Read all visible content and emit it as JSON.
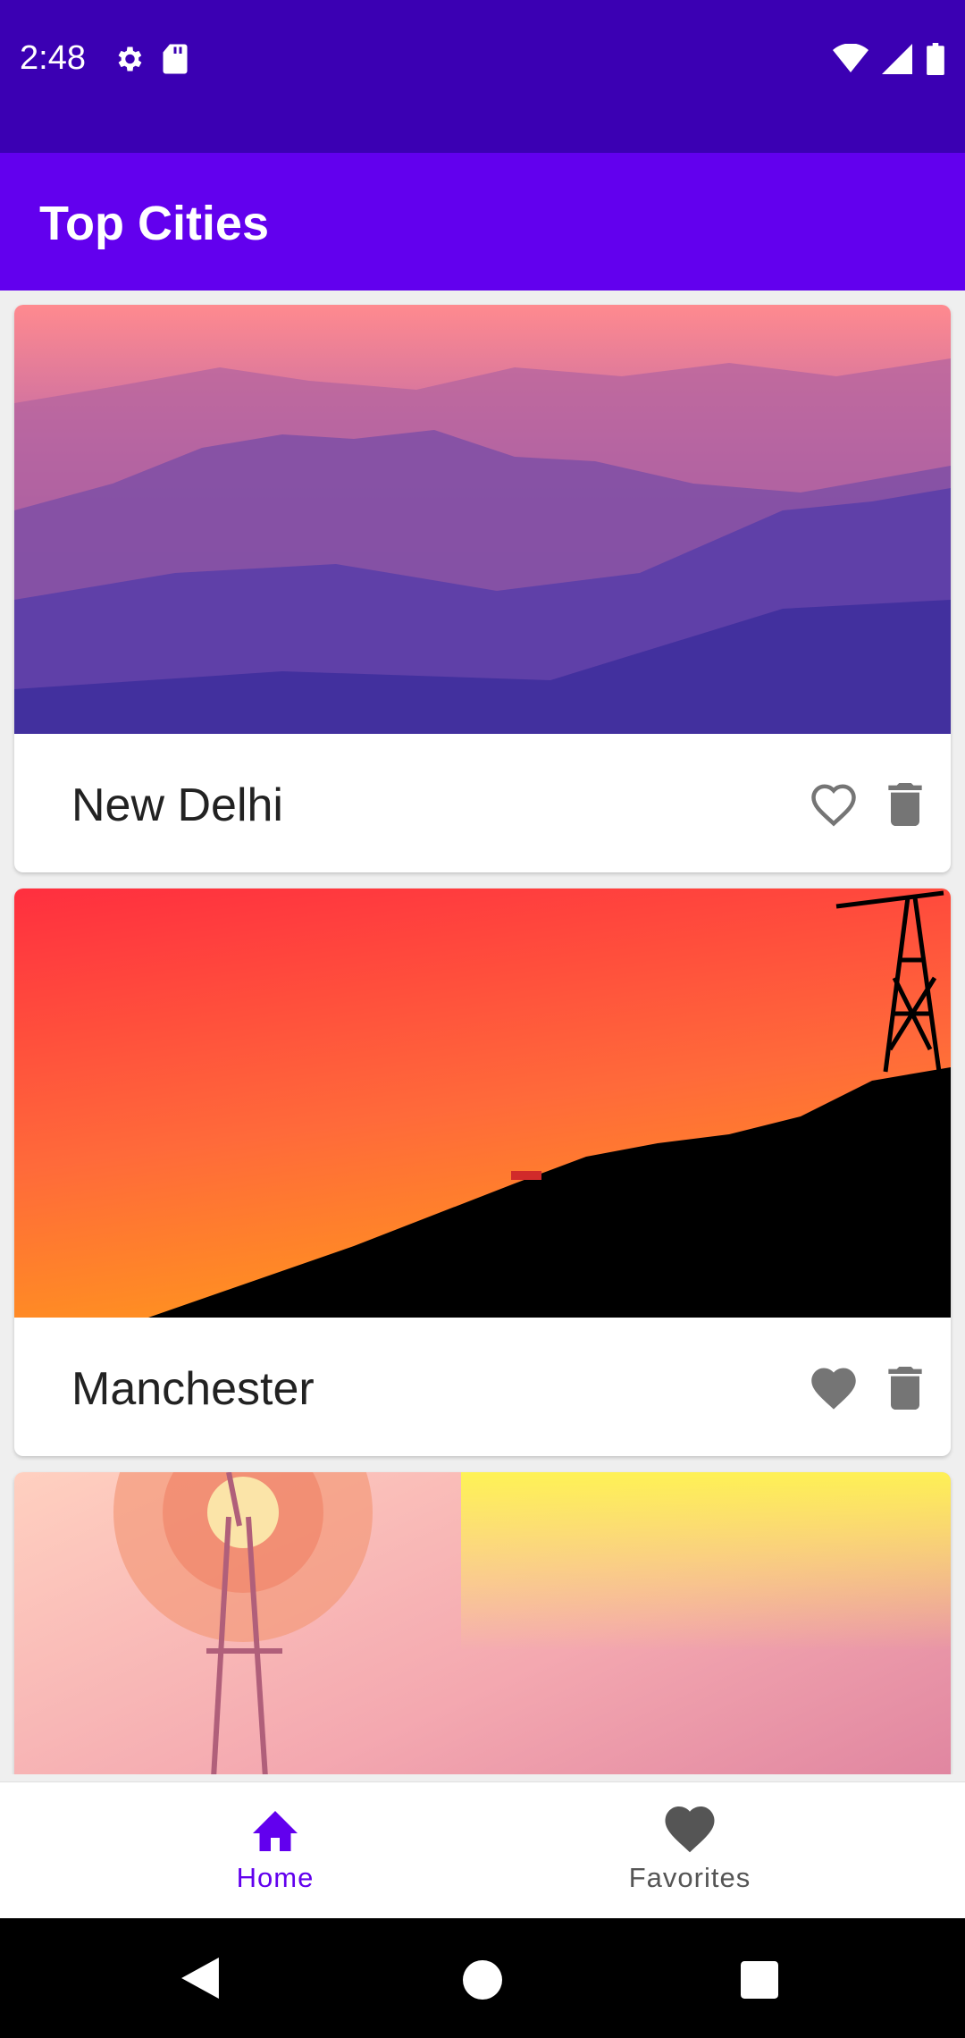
{
  "status_bar": {
    "time": "2:48",
    "left_icons": [
      "settings-icon",
      "sd-card-icon"
    ],
    "right_icons": [
      "wifi-icon",
      "cellular-signal-icon",
      "battery-icon"
    ]
  },
  "app_bar": {
    "title": "Top Cities"
  },
  "cities": [
    {
      "name": "New Delhi",
      "favorite": false,
      "image": "mountain-sunset-photo"
    },
    {
      "name": "Manchester",
      "favorite": true,
      "image": "hill-tower-sunset-photo"
    },
    {
      "name": "",
      "favorite": null,
      "image": "windmill-sunset-photo"
    }
  ],
  "bottom_nav": {
    "items": [
      {
        "label": "Home",
        "icon": "home-icon",
        "active": true
      },
      {
        "label": "Favorites",
        "icon": "heart-icon",
        "active": false
      }
    ]
  },
  "colors": {
    "status_bar": "#3b00b3",
    "app_bar": "#6200ee",
    "nav_active": "#6200ee",
    "icon_gray": "#757575"
  }
}
